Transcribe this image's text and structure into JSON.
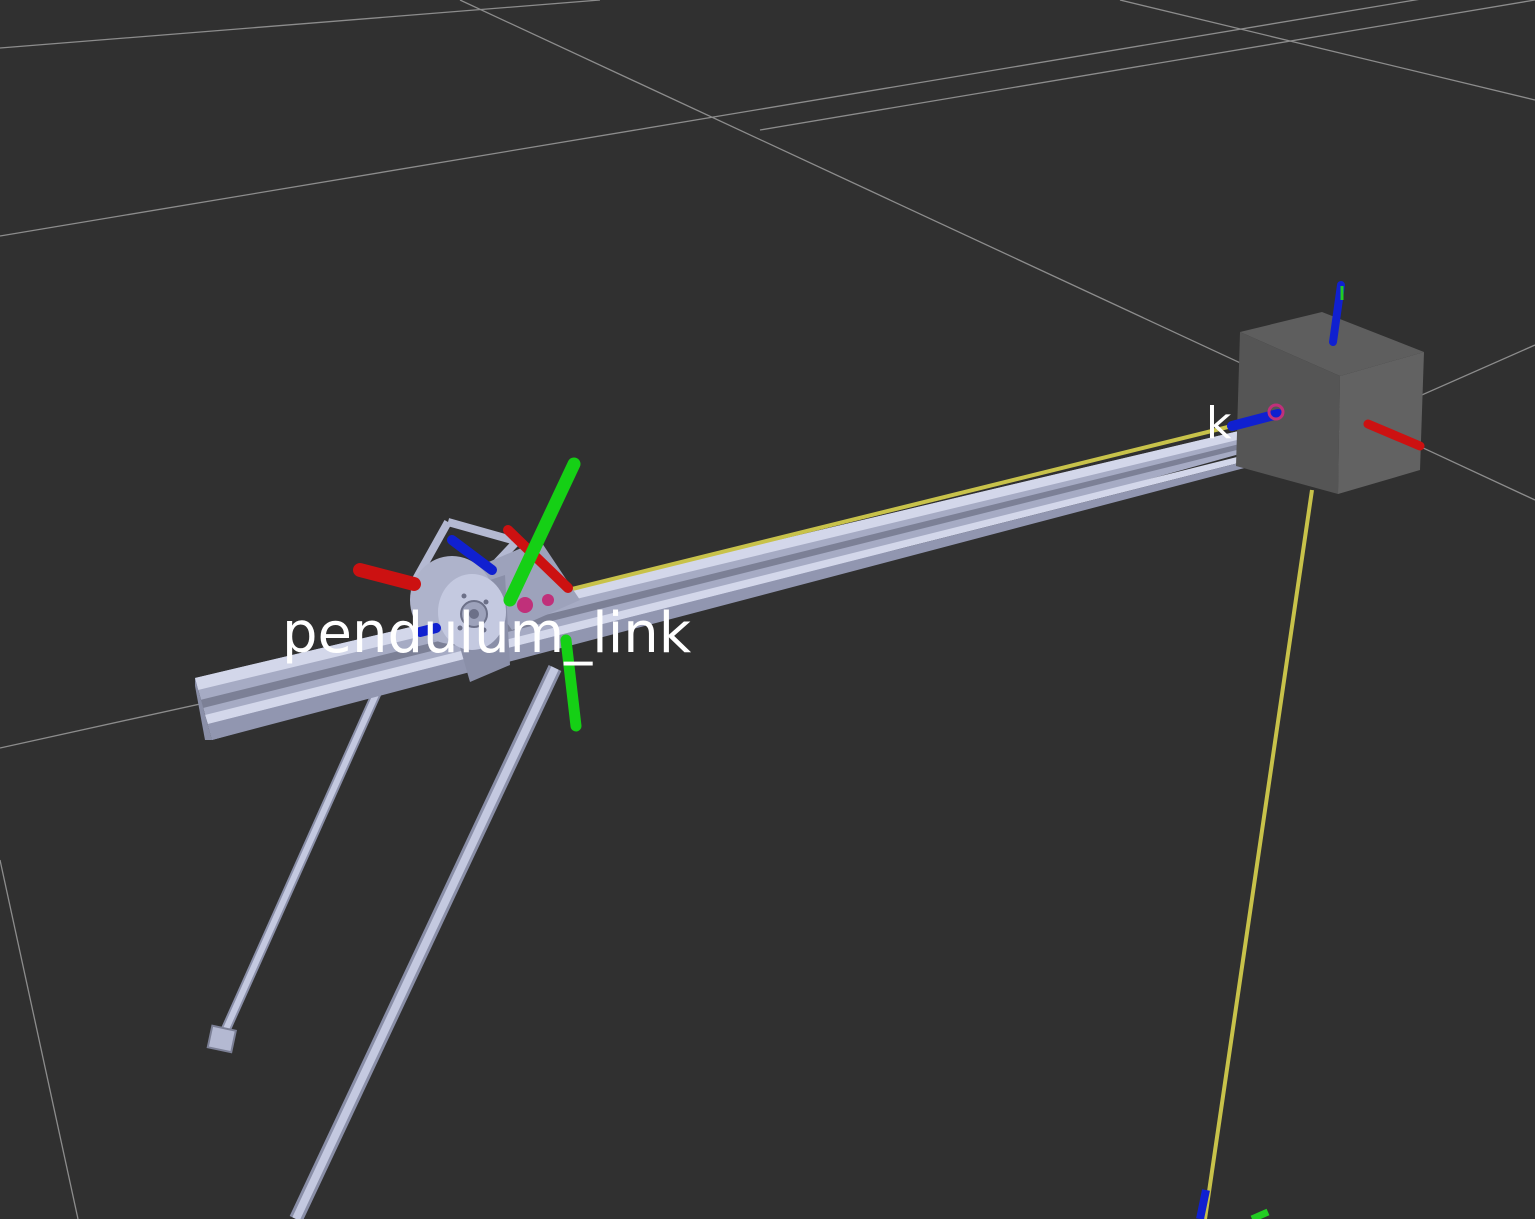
{
  "viewport": {
    "background": "#303030",
    "grid_color": "#a0a0a0"
  },
  "labels": {
    "pendulum_link": "pendulum_link",
    "right_link": "k"
  },
  "colors": {
    "x_axis": "#dd0000",
    "y_axis": "#00dd00",
    "z_axis": "#0000dd",
    "aluminum": "#b4b9d2",
    "aluminum_shadow": "#8a8fa8",
    "cable": "#c8c24a",
    "box": "#5a5a5a",
    "accent": "#c0307a"
  },
  "icons": {
    "frame_axes": "xyz-axes-icon"
  }
}
